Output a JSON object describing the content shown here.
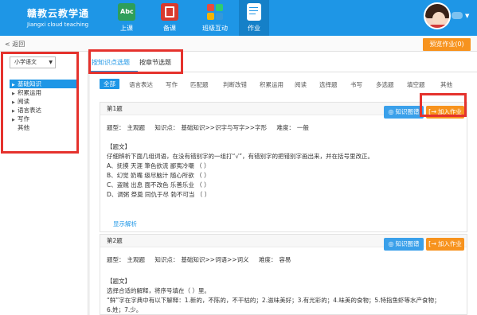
{
  "brand": {
    "title_cn": "赣教云教学通",
    "title_en": "Jiangxi cloud teaching"
  },
  "nav": [
    {
      "label": "上课",
      "icon": "abc-board-icon",
      "color": "#2e9e5a"
    },
    {
      "label": "备课",
      "icon": "book-icon",
      "color": "#d83a2e"
    },
    {
      "label": "班级互动",
      "icon": "grid-apps-icon",
      "color": "#f4b400"
    },
    {
      "label": "作业",
      "icon": "homework-doc-icon",
      "color": "#ffffff"
    }
  ],
  "subbar": {
    "back_label": "返回",
    "preview_label": "预览作业(0)"
  },
  "left": {
    "subject_select": "小学语文",
    "tree": [
      {
        "label": "基础知识",
        "expandable": true,
        "selected": true
      },
      {
        "label": "积累运用",
        "expandable": true,
        "selected": false
      },
      {
        "label": "阅读",
        "expandable": true,
        "selected": false
      },
      {
        "label": "语言表达",
        "expandable": true,
        "selected": false
      },
      {
        "label": "写作",
        "expandable": true,
        "selected": false
      },
      {
        "label": "其他",
        "expandable": false,
        "selected": false
      }
    ]
  },
  "tabs": [
    {
      "label": "按知识点选题",
      "active": true
    },
    {
      "label": "按章节选题",
      "active": false
    }
  ],
  "question_types": [
    "全部",
    "语言表达",
    "写作",
    "匹配题",
    "判断改错",
    "积累运用",
    "阅读",
    "选择题",
    "书写",
    "多选题",
    "填空题",
    "其他"
  ],
  "questions": [
    {
      "title": "第1题",
      "type_label": "题型：",
      "type_value": "主观题",
      "knowledge_label": "知识点：",
      "knowledge_value": "基础知识>>识字与写字>>字形",
      "difficulty_label": "难度：",
      "difficulty_value": "一般",
      "body_lines": [
        "【题文】",
        "仔细辨析下面几组词语，在没有错别字的一组打“√”，有错别字的把错别字画出来，并在括号里改正。",
        "A、抚摸  天涯  筆色欲流  鄙夷冷嘲  （    ）",
        "B、幻觉  奶嘴  级尽脑汁  随心所欲  （    ）",
        "C、盗贼  出息  面不改色  乐善乐业  （    ）",
        "D、调粥  祭奠  同仇于尽  勃不可当  （    ）"
      ],
      "show_answer": "显示解析",
      "knowledge_btn": "知识图谱",
      "add_btn": "加入作业"
    },
    {
      "title": "第2题",
      "type_label": "题型：",
      "type_value": "主观题",
      "knowledge_label": "知识点：",
      "knowledge_value": "基础知识>>词语>>词义",
      "difficulty_label": "难度：",
      "difficulty_value": "容易",
      "body_lines": [
        "【题文】",
        "选择合适的解释，将序号填在（  ）里。",
        "“鲜”字在字典中有以下解释：1.新的，不陈的，不干枯的；2.滋味美好；3.有光彩的；4.味美的食物；5.特指鱼虾等水产食物；",
        "6.姓；7.少。"
      ],
      "knowledge_btn": "知识图谱",
      "add_btn": "加入作业"
    }
  ],
  "colors": {
    "header": "#1e96e6",
    "accent_orange": "#f7931e",
    "highlight_box": "#e5322d"
  }
}
